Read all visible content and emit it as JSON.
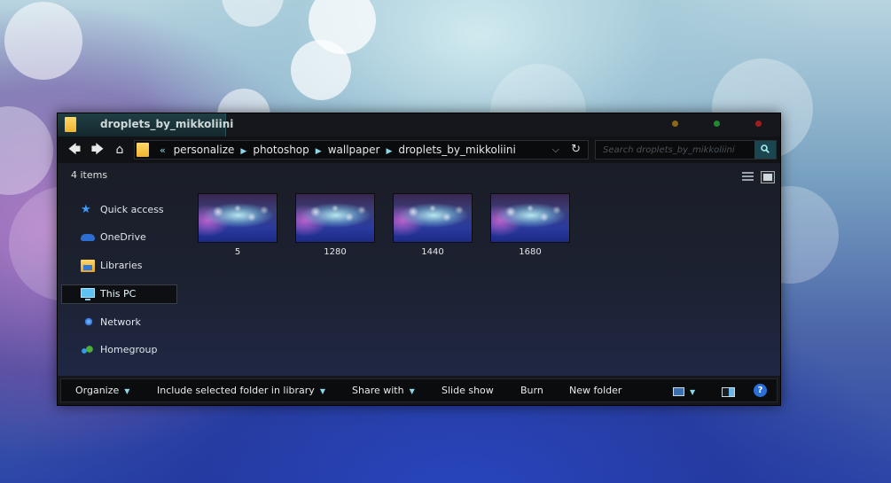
{
  "window": {
    "title": "droplets_by_mikkoliini",
    "title_icon": "folder-icon",
    "accent_color": "#8fd7e8"
  },
  "nav": {
    "back_icon": "back-arrow-icon",
    "forward_icon": "forward-arrow-icon",
    "home_icon": "home-icon",
    "overflow": "«",
    "breadcrumbs": [
      "personalize",
      "photoshop",
      "wallpaper",
      "droplets_by_mikkoliini"
    ],
    "refresh_glyph": "↻"
  },
  "search": {
    "placeholder": "Search droplets_by_mikkoliini"
  },
  "status": {
    "item_count": "4 items"
  },
  "sidebar": {
    "items": [
      {
        "label": "Quick access",
        "icon": "star-icon"
      },
      {
        "label": "OneDrive",
        "icon": "cloud-icon"
      },
      {
        "label": "Libraries",
        "icon": "libraries-icon"
      },
      {
        "label": "This PC",
        "icon": "monitor-icon",
        "selected": true
      },
      {
        "label": "Network",
        "icon": "network-icon"
      },
      {
        "label": "Homegroup",
        "icon": "homegroup-icon"
      }
    ]
  },
  "files": [
    {
      "name": "5"
    },
    {
      "name": "1280"
    },
    {
      "name": "1440"
    },
    {
      "name": "1680"
    }
  ],
  "toolbar": {
    "organize": "Organize",
    "include": "Include selected folder in library",
    "share": "Share with",
    "slideshow": "Slide show",
    "burn": "Burn",
    "new_folder": "New folder",
    "help": "?"
  }
}
